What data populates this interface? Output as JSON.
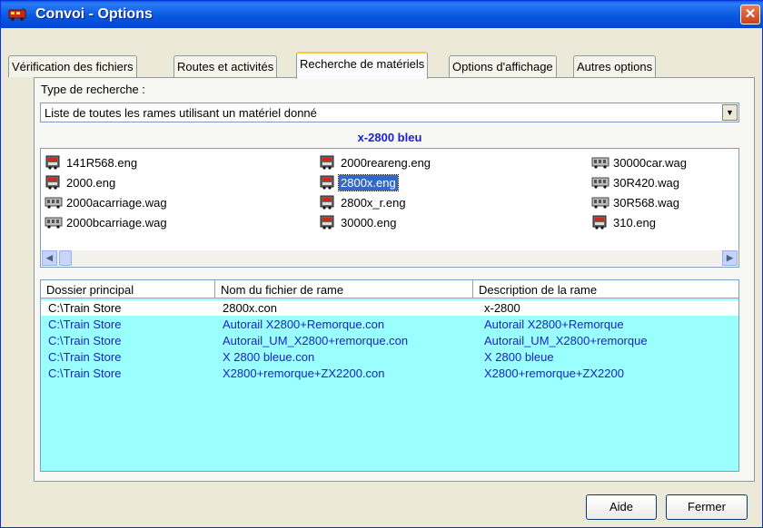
{
  "window": {
    "title": "Convoi - Options",
    "close_symbol": "✕"
  },
  "tabs": [
    {
      "label": "Vérification des fichiers"
    },
    {
      "label": "Routes et activités"
    },
    {
      "label": "Recherche de matériels"
    },
    {
      "label": "Options d'affichage"
    },
    {
      "label": "Autres options"
    }
  ],
  "search": {
    "label": "Type de recherche :",
    "value": "Liste de toutes les rames utilisant un matériel donné",
    "dropdown_symbol": "▼"
  },
  "selected_item_title": "x-2800 bleu",
  "files": [
    {
      "name": "141R568.eng",
      "icon": "locomotive-icon"
    },
    {
      "name": "2000.eng",
      "icon": "locomotive-icon"
    },
    {
      "name": "2000acarriage.wag",
      "icon": "wagon-icon"
    },
    {
      "name": "2000bcarriage.wag",
      "icon": "wagon-icon"
    },
    {
      "name": "2000reareng.eng",
      "icon": "locomotive-icon"
    },
    {
      "name": "2800x.eng",
      "icon": "locomotive-icon",
      "selected": true
    },
    {
      "name": "2800x_r.eng",
      "icon": "locomotive-icon"
    },
    {
      "name": "30000.eng",
      "icon": "locomotive-icon"
    },
    {
      "name": "30000car.wag",
      "icon": "wagon-icon"
    },
    {
      "name": "30R420.wag",
      "icon": "wagon-icon"
    },
    {
      "name": "30R568.wag",
      "icon": "wagon-icon"
    },
    {
      "name": "310.eng",
      "icon": "locomotive-icon"
    }
  ],
  "scroll": {
    "left_symbol": "◀",
    "right_symbol": "▶"
  },
  "table": {
    "columns": [
      "Dossier principal",
      "Nom du fichier de rame",
      "Description de la rame"
    ],
    "rows": [
      [
        "C:\\Train Store",
        "2800x.con",
        "x-2800"
      ],
      [
        "C:\\Train Store",
        "Autorail X2800+Remorque.con",
        "Autorail X2800+Remorque"
      ],
      [
        "C:\\Train Store",
        "Autorail_UM_X2800+remorque.con",
        "Autorail_UM_X2800+remorque"
      ],
      [
        "C:\\Train Store",
        "X 2800 bleue.con",
        "X 2800 bleue"
      ],
      [
        "C:\\Train Store",
        "X2800+remorque+ZX2200.con",
        "X2800+remorque+ZX2200"
      ]
    ]
  },
  "buttons": {
    "help": "Aide",
    "close": "Fermer"
  },
  "colors": {
    "title_bar": "#0858e0",
    "list_highlight": "#99ffff",
    "link_text": "#1a22cc",
    "selection": "#316ac5"
  }
}
